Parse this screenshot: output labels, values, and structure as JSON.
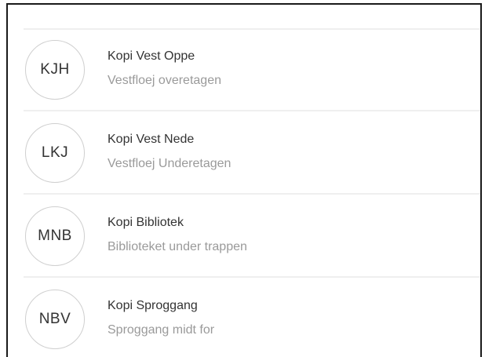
{
  "printers": [
    {
      "initials": "KJH",
      "title": "Kopi Vest Oppe",
      "subtitle": "Vestfloej overetagen"
    },
    {
      "initials": "LKJ",
      "title": "Kopi Vest Nede",
      "subtitle": "Vestfloej Underetagen"
    },
    {
      "initials": "MNB",
      "title": "Kopi Bibliotek",
      "subtitle": "Biblioteket under trappen"
    },
    {
      "initials": "NBV",
      "title": "Kopi Sproggang",
      "subtitle": "Sproggang midt for"
    }
  ]
}
